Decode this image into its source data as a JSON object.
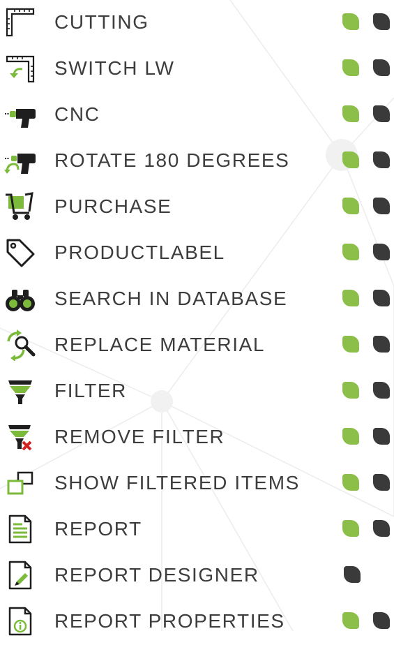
{
  "colors": {
    "text": "#3d3d3d",
    "available": "#8cbf4a",
    "dark": "#3a3a3a",
    "icon_dark": "#1e1e1e",
    "icon_green": "#7cba3c",
    "icon_red": "#d32222"
  },
  "items": [
    {
      "label": "CUTTING",
      "icon": "cutting-icon",
      "green": true,
      "dark": true
    },
    {
      "label": "SWITCH LW",
      "icon": "switch-lw-icon",
      "green": true,
      "dark": true
    },
    {
      "label": "CNC",
      "icon": "cnc-drill-icon",
      "green": true,
      "dark": true
    },
    {
      "label": "ROTATE 180 DEGREES",
      "icon": "rotate-drill-icon",
      "green": true,
      "dark": true
    },
    {
      "label": "PURCHASE",
      "icon": "cart-icon",
      "green": true,
      "dark": true
    },
    {
      "label": "PRODUCTLABEL",
      "icon": "tag-icon",
      "green": true,
      "dark": true
    },
    {
      "label": "SEARCH IN DATABASE",
      "icon": "binoculars-icon",
      "green": true,
      "dark": true
    },
    {
      "label": "REPLACE MATERIAL",
      "icon": "replace-icon",
      "green": true,
      "dark": true
    },
    {
      "label": "FILTER",
      "icon": "filter-icon",
      "green": true,
      "dark": true
    },
    {
      "label": "REMOVE FILTER",
      "icon": "remove-filter-icon",
      "green": true,
      "dark": true
    },
    {
      "label": "SHOW FILTERED ITEMS",
      "icon": "windows-icon",
      "green": true,
      "dark": true
    },
    {
      "label": "REPORT",
      "icon": "report-icon",
      "green": true,
      "dark": true
    },
    {
      "label": "REPORT DESIGNER",
      "icon": "report-designer-icon",
      "green": false,
      "dark": true
    },
    {
      "label": "REPORT PROPERTIES",
      "icon": "report-properties-icon",
      "green": true,
      "dark": true
    }
  ]
}
